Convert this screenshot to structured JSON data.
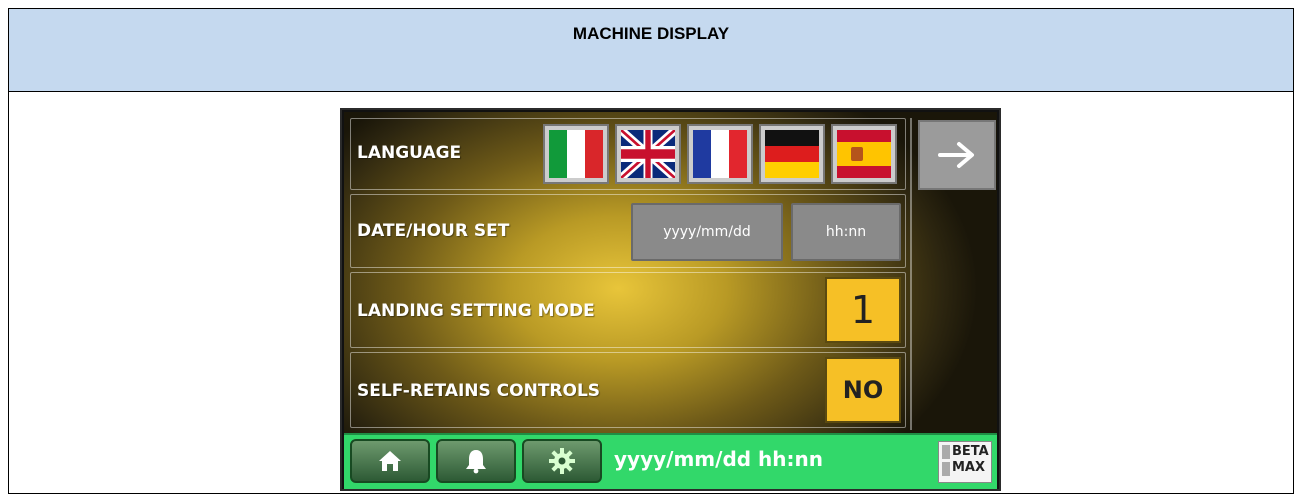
{
  "header": {
    "title": "MACHINE DISPLAY"
  },
  "rows": {
    "language": {
      "label": "LANGUAGE",
      "flags": [
        "italian-flag-icon",
        "uk-flag-icon",
        "french-flag-icon",
        "german-flag-icon",
        "spanish-flag-icon"
      ]
    },
    "date_hour": {
      "label": "DATE/HOUR SET",
      "date_button": "yyyy/mm/dd",
      "hour_button": "hh:nn"
    },
    "landing": {
      "label": "LANDING SETTING MODE",
      "value": "1"
    },
    "self_retains": {
      "label": "SELF-RETAINS CONTROLS",
      "value": "NO"
    }
  },
  "nav": {
    "next": "arrow-right-icon"
  },
  "status_bar": {
    "icons": [
      "home-icon",
      "bell-icon",
      "gear-icon"
    ],
    "datetime": "yyyy/mm/dd hh:nn",
    "logo_line1": "BETA",
    "logo_line2": "MAX"
  },
  "colors": {
    "status_green": "#32d86a",
    "value_yellow": "#f6c026",
    "header_blue": "#c5d9ef"
  }
}
